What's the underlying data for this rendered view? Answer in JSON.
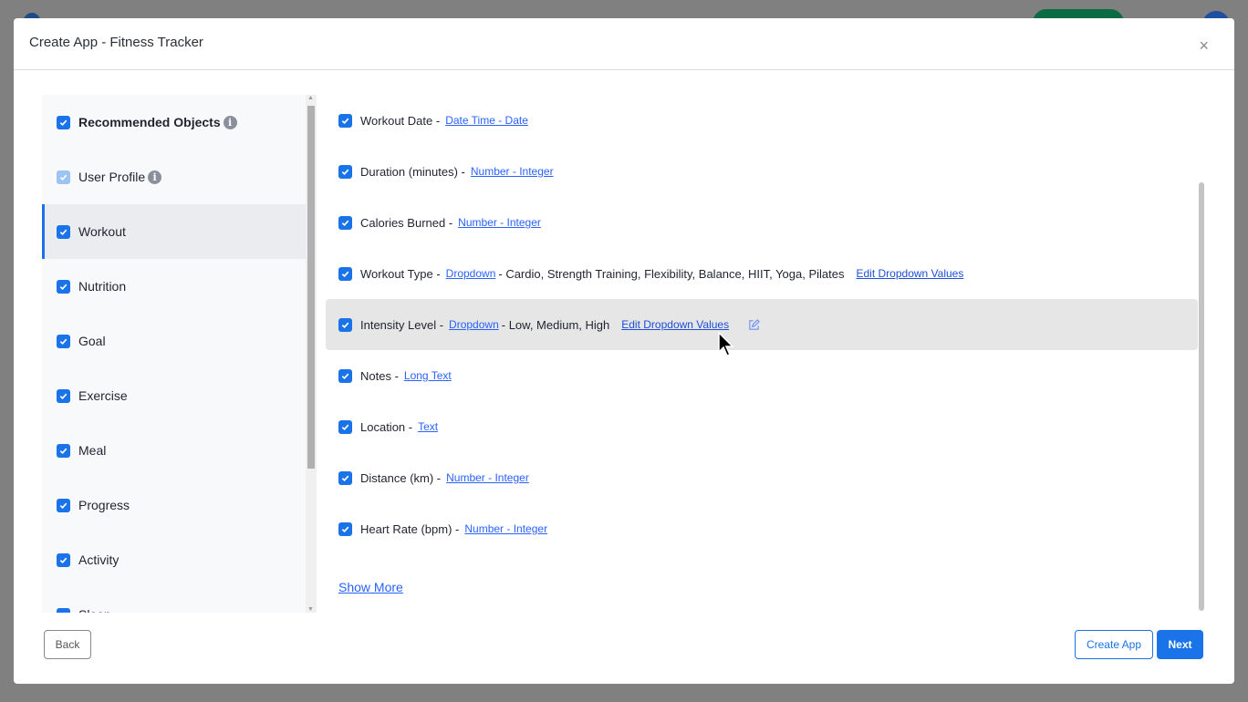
{
  "modal": {
    "title": "Create App - Fitness Tracker",
    "close": "×"
  },
  "sidebar": {
    "items": [
      {
        "label": "Recommended Objects",
        "info": true,
        "bold": true
      },
      {
        "label": "User Profile",
        "info": true,
        "light": true
      },
      {
        "label": "Workout",
        "active": true
      },
      {
        "label": "Nutrition"
      },
      {
        "label": "Goal"
      },
      {
        "label": "Exercise"
      },
      {
        "label": "Meal"
      },
      {
        "label": "Progress"
      },
      {
        "label": "Activity"
      },
      {
        "label": "Sleep"
      }
    ]
  },
  "fields": [
    {
      "name": "Workout Date -",
      "type": "Date Time - Date"
    },
    {
      "name": "Duration (minutes) -",
      "type": "Number - Integer"
    },
    {
      "name": "Calories Burned -",
      "type": "Number - Integer"
    },
    {
      "name": "Workout Type -",
      "type": "Dropdown",
      "values": "- Cardio, Strength Training, Flexibility, Balance, HIIT, Yoga, Pilates",
      "edit": "Edit Dropdown Values"
    },
    {
      "name": "Intensity Level -",
      "type": "Dropdown",
      "values": "- Low, Medium, High",
      "edit": "Edit Dropdown Values",
      "hover": true
    },
    {
      "name": "Notes -",
      "type": "Long Text"
    },
    {
      "name": "Location -",
      "type": "Text"
    },
    {
      "name": "Distance (km) -",
      "type": "Number - Integer"
    },
    {
      "name": "Heart Rate (bpm) -",
      "type": "Number - Integer"
    }
  ],
  "show_more": "Show More",
  "footer": {
    "back": "Back",
    "create": "Create App",
    "next": "Next"
  },
  "colors": {
    "accent": "#1a73e8",
    "link": "#2962ff"
  }
}
